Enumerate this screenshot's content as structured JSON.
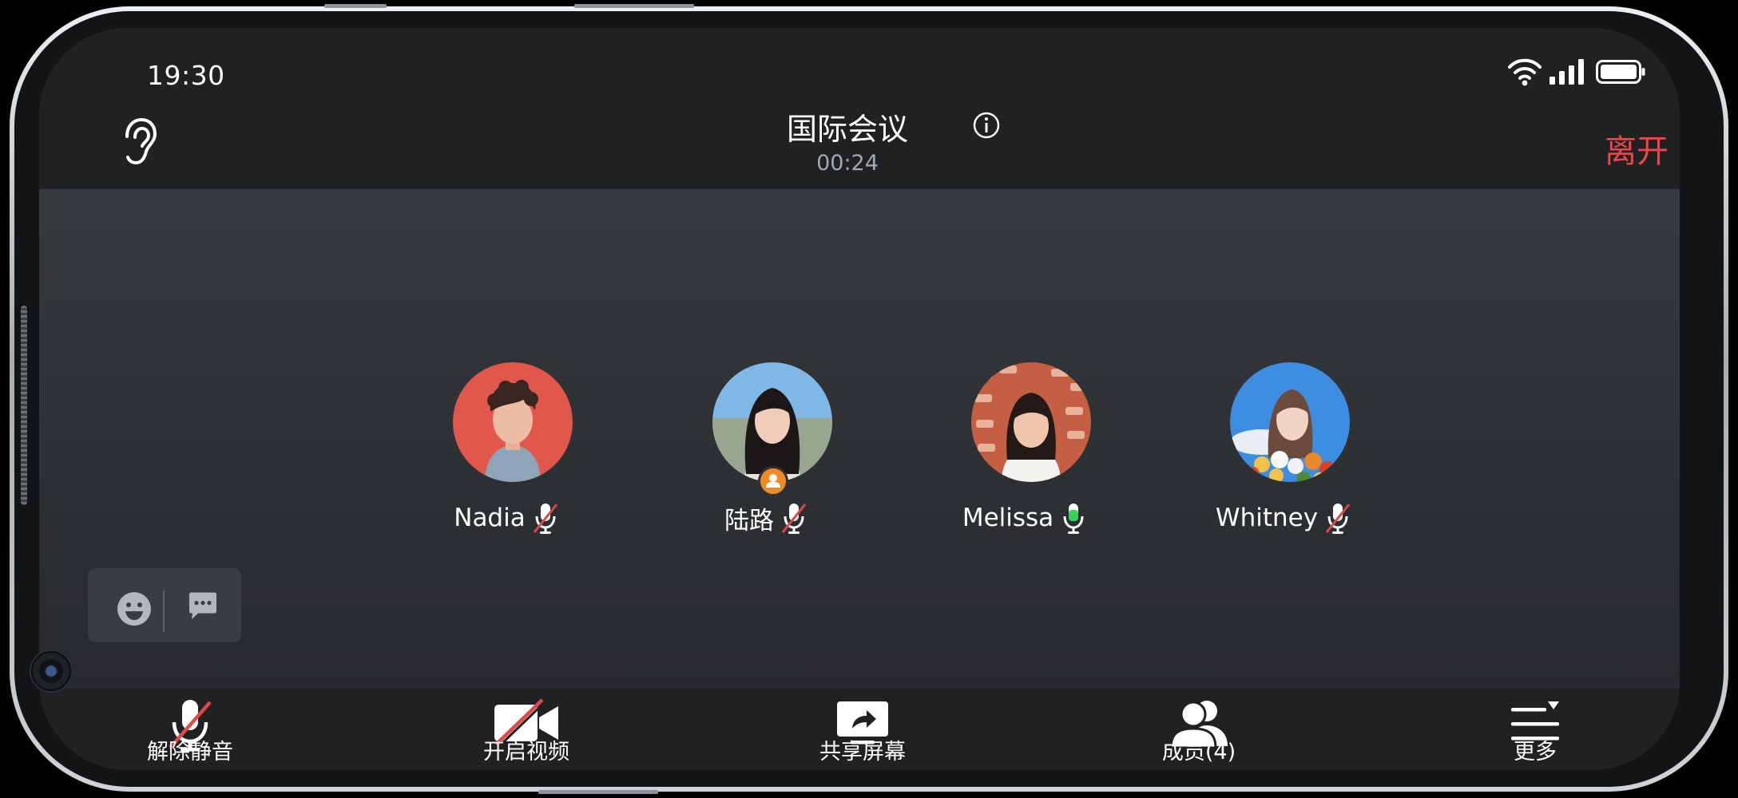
{
  "status_bar": {
    "time": "19:30"
  },
  "header": {
    "title": "国际会议",
    "timer": "00:24",
    "leave_label": "离开"
  },
  "participants": [
    {
      "name": "Nadia",
      "mic": "muted"
    },
    {
      "name": "陆路",
      "mic": "muted",
      "is_host": true
    },
    {
      "name": "Melissa",
      "mic": "speaking"
    },
    {
      "name": "Whitney",
      "mic": "muted"
    }
  ],
  "toolbar": {
    "unmute_label": "解除静音",
    "video_label": "开启视频",
    "share_label": "共享屏幕",
    "members_label": "成员(4)",
    "more_label": "更多"
  },
  "colors": {
    "leave": "#f2454a",
    "muted_slash": "#e04848",
    "speaking": "#3ad15a",
    "host_badge": "#f08a24"
  }
}
